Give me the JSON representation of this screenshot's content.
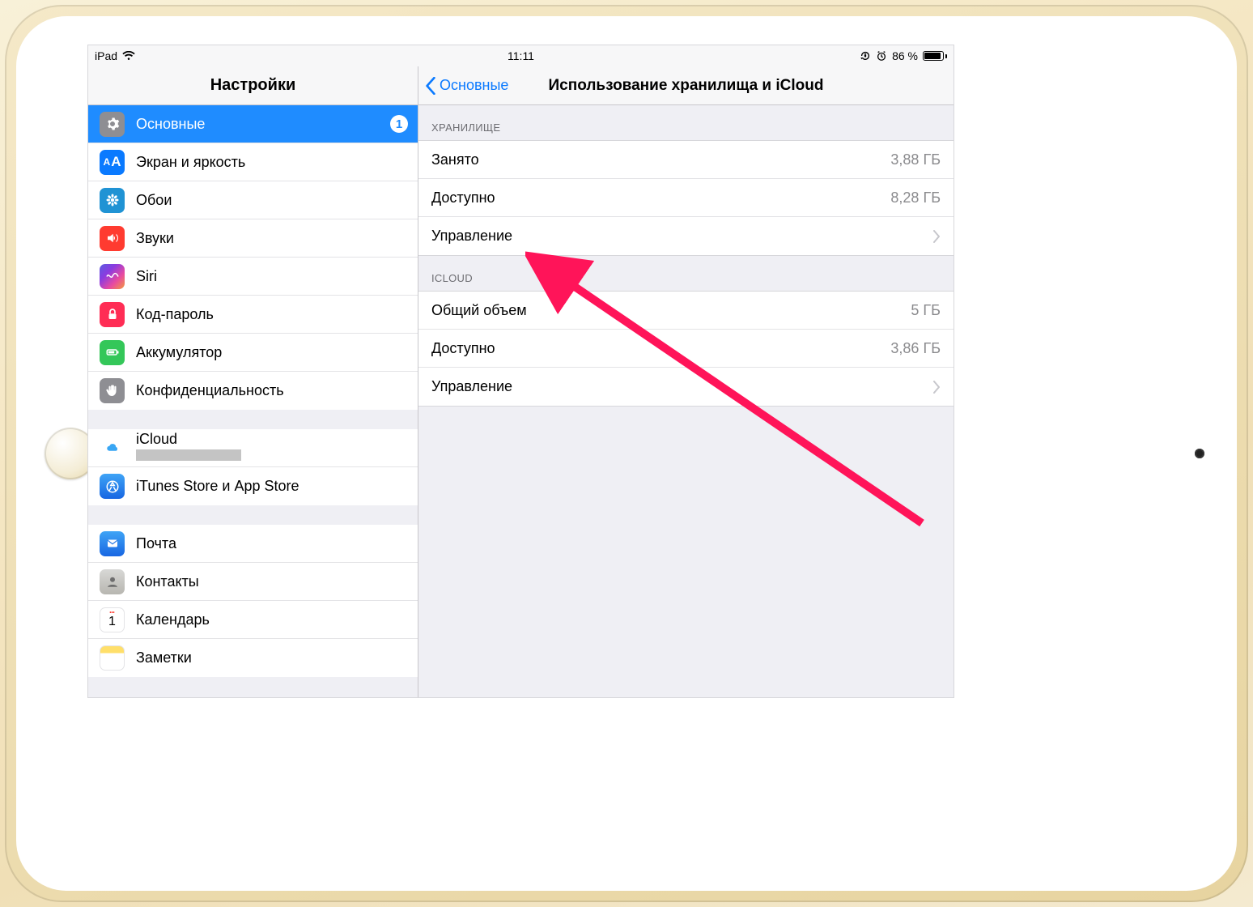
{
  "status": {
    "device": "iPad",
    "time": "11:11",
    "battery_text": "86 %"
  },
  "sidebar": {
    "title": "Настройки",
    "groups": [
      {
        "items": [
          {
            "label": "Основные",
            "badge": "1",
            "selected": true,
            "icon": "gear"
          },
          {
            "label": "Экран и яркость",
            "icon": "text-size"
          },
          {
            "label": "Обои",
            "icon": "flower"
          },
          {
            "label": "Звуки",
            "icon": "speaker"
          },
          {
            "label": "Siri",
            "icon": "siri"
          },
          {
            "label": "Код-пароль",
            "icon": "lock"
          },
          {
            "label": "Аккумулятор",
            "icon": "battery"
          },
          {
            "label": "Конфиденциальность",
            "icon": "hand"
          }
        ]
      },
      {
        "items": [
          {
            "label": "iCloud",
            "icon": "cloud",
            "has_sub": true
          },
          {
            "label": "iTunes Store и App Store",
            "icon": "appstore"
          }
        ]
      },
      {
        "items": [
          {
            "label": "Почта",
            "icon": "mail"
          },
          {
            "label": "Контакты",
            "icon": "contacts"
          },
          {
            "label": "Календарь",
            "icon": "calendar"
          },
          {
            "label": "Заметки",
            "icon": "notes"
          }
        ]
      }
    ]
  },
  "detail": {
    "back_label": "Основные",
    "title": "Использование хранилища и iCloud",
    "sections": [
      {
        "header": "ХРАНИЛИЩЕ",
        "rows": [
          {
            "label": "Занято",
            "value": "3,88 ГБ"
          },
          {
            "label": "Доступно",
            "value": "8,28 ГБ"
          },
          {
            "label": "Управление",
            "chevron": true
          }
        ]
      },
      {
        "header": "ICLOUD",
        "rows": [
          {
            "label": "Общий объем",
            "value": "5 ГБ"
          },
          {
            "label": "Доступно",
            "value": "3,86 ГБ"
          },
          {
            "label": "Управление",
            "chevron": true
          }
        ]
      }
    ]
  }
}
